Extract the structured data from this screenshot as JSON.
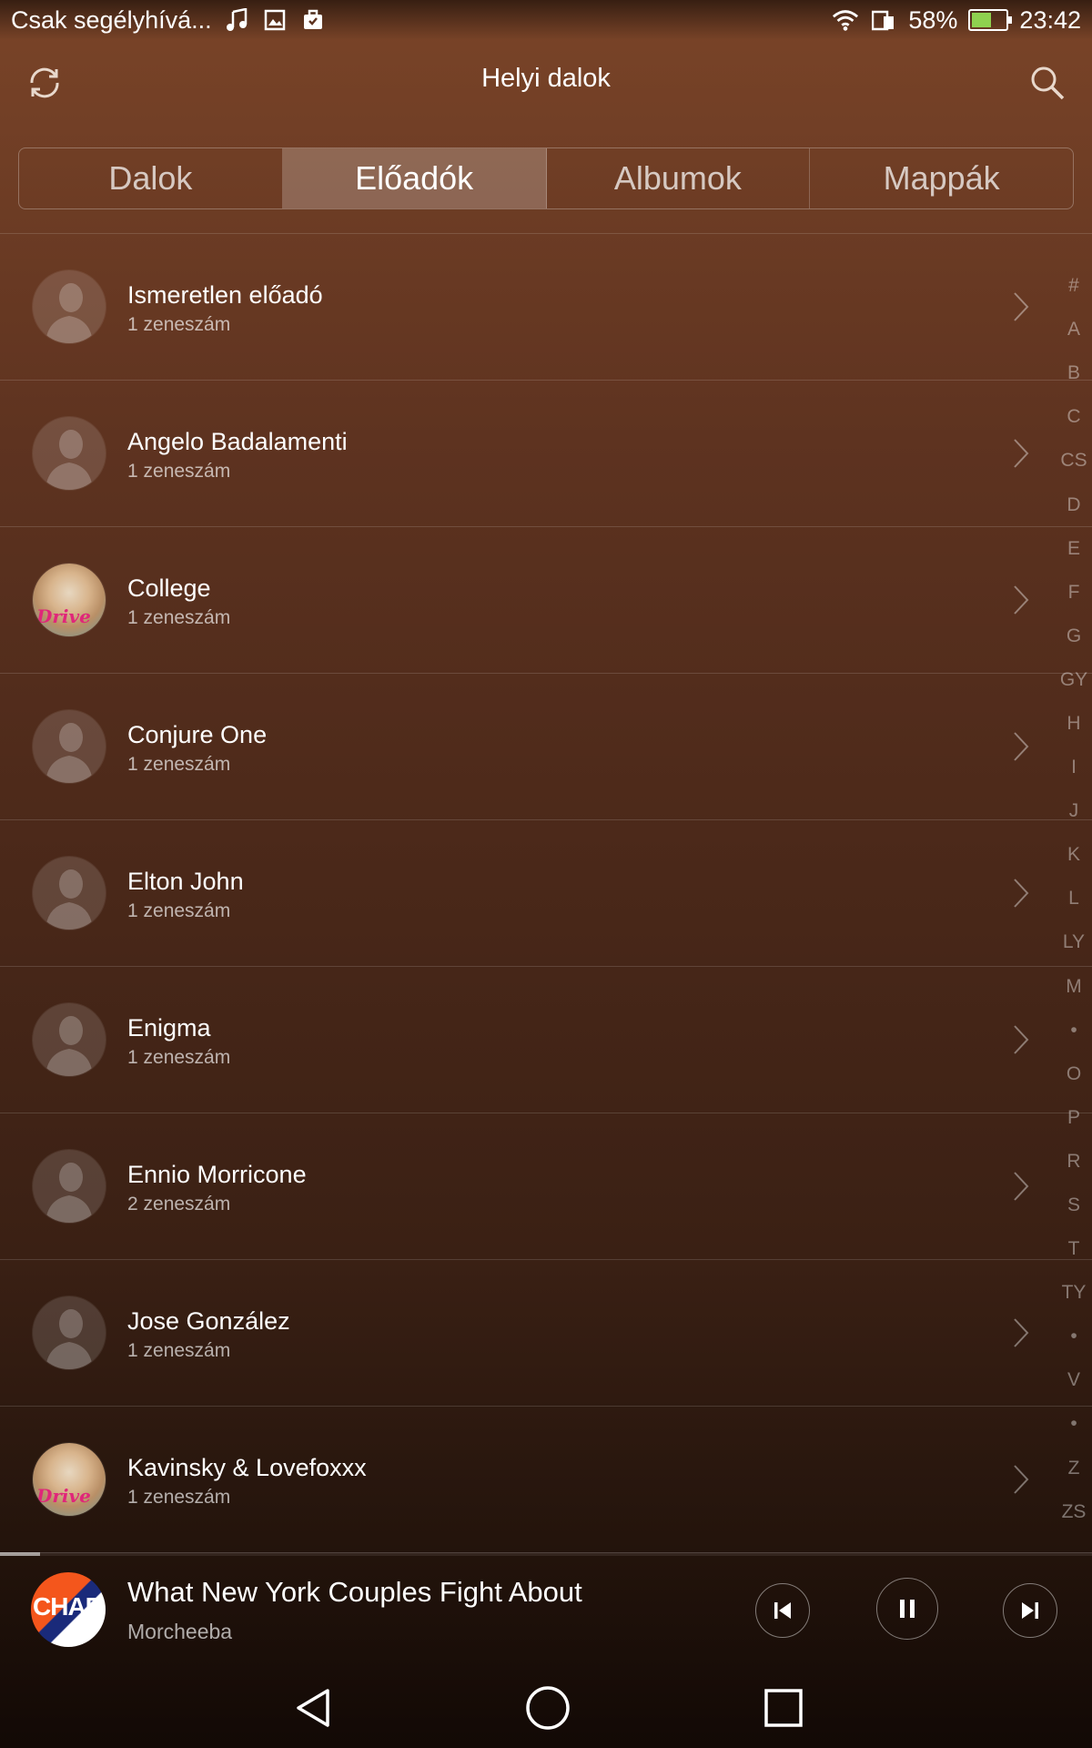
{
  "status_bar": {
    "carrier": "Csak segélyhívá...",
    "battery_percent": "58%",
    "battery_level": 0.58,
    "time": "23:42",
    "icons": [
      "music-note-icon",
      "image-icon",
      "briefcase-icon",
      "wifi-icon",
      "sim-icon",
      "battery-icon"
    ]
  },
  "header": {
    "title": "Helyi dalok",
    "left_icon": "refresh-icon",
    "right_icon": "search-icon"
  },
  "tabs": [
    {
      "label": "Dalok",
      "active": false
    },
    {
      "label": "Előadók",
      "active": true
    },
    {
      "label": "Albumok",
      "active": false
    },
    {
      "label": "Mappák",
      "active": false
    }
  ],
  "artists": [
    {
      "name": "Ismeretlen előadó",
      "count": "1 zeneszám",
      "avatar": "placeholder"
    },
    {
      "name": "Angelo Badalamenti",
      "count": "1 zeneszám",
      "avatar": "placeholder"
    },
    {
      "name": "College",
      "count": "1 zeneszám",
      "avatar": "album-art"
    },
    {
      "name": "Conjure One",
      "count": "1 zeneszám",
      "avatar": "placeholder"
    },
    {
      "name": "Elton John",
      "count": "1 zeneszám",
      "avatar": "placeholder"
    },
    {
      "name": "Enigma",
      "count": "1 zeneszám",
      "avatar": "placeholder"
    },
    {
      "name": "Ennio Morricone",
      "count": "2 zeneszám",
      "avatar": "placeholder"
    },
    {
      "name": "Jose González",
      "count": "1 zeneszám",
      "avatar": "placeholder"
    },
    {
      "name": "Kavinsky & Lovefoxxx",
      "count": "1 zeneszám",
      "avatar": "album-art"
    }
  ],
  "alpha_index": [
    "#",
    "A",
    "B",
    "C",
    "CS",
    "D",
    "E",
    "F",
    "G",
    "GY",
    "H",
    "I",
    "J",
    "K",
    "L",
    "LY",
    "M",
    "•",
    "O",
    "P",
    "R",
    "S",
    "T",
    "TY",
    "•",
    "V",
    "•",
    "Z",
    "ZS"
  ],
  "now_playing": {
    "title": "What New York Couples Fight About",
    "artist": "Morcheeba",
    "progress": 0.037,
    "controls": [
      "previous-icon",
      "pause-icon",
      "next-icon"
    ]
  },
  "nav_bar": {
    "buttons": [
      "back-icon",
      "home-icon",
      "recents-icon"
    ]
  },
  "colors": {
    "background_top": "#7a4428",
    "background_bottom": "#120905",
    "text_primary": "#ffffff"
  }
}
